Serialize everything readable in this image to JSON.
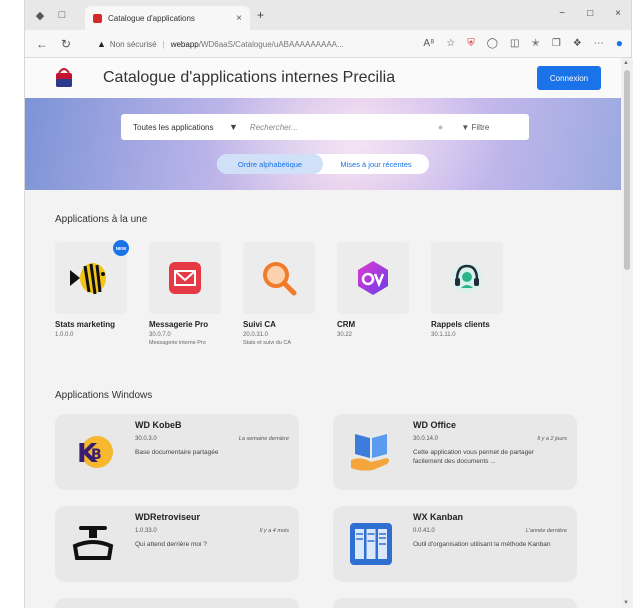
{
  "browser": {
    "tab_title": "Catalogue d'applications",
    "tab_close": "×",
    "new_tab": "+",
    "window_controls": [
      "−",
      "□",
      "×"
    ],
    "url_warning": "Non sécurisé",
    "url_separator": "|",
    "url_host": "webapp",
    "url_path": "/WD6aaS/Catalogue/uABAAAAAAAAA..."
  },
  "header": {
    "title": "Catalogue d'applications internes Precilia",
    "login_label": "Connexion"
  },
  "search": {
    "category": "Toutes les applications",
    "placeholder": "Rechercher...",
    "filter_label": "Filtre"
  },
  "sort_tabs": [
    {
      "label": "Ordre alphabétique",
      "active": true
    },
    {
      "label": "Mises à jour récentes",
      "active": false
    }
  ],
  "featured": {
    "title": "Applications à la une",
    "items": [
      {
        "name": "Stats marketing",
        "version": "1.0.0.0",
        "desc": "",
        "badge": "NEW",
        "icon": "fish-icon"
      },
      {
        "name": "Messagerie Pro",
        "version": "30.0.7.0",
        "desc": "Messagerie interne Pro",
        "icon": "mail-icon"
      },
      {
        "name": "Suivi CA",
        "version": "20.0.31.0",
        "desc": "Stats et suivi du CA",
        "icon": "magnifier-icon"
      },
      {
        "name": "CRM",
        "version": "30.22",
        "desc": "",
        "icon": "crm-icon"
      },
      {
        "name": "Rappels clients",
        "version": "30.1.11.0",
        "desc": "",
        "icon": "headset-icon"
      }
    ]
  },
  "windows": {
    "title": "Applications Windows",
    "items": [
      {
        "name": "WD KobeB",
        "version": "30.0.3.0",
        "date": "La semaine dernière",
        "desc": "Base documentaire partagée",
        "icon": "kb-logo-icon"
      },
      {
        "name": "WD Office",
        "version": "30.0.14.0",
        "date": "Il y a 2 jours",
        "desc": "Cette application vous permet de partager facilement des documents ...",
        "icon": "book-hand-icon"
      },
      {
        "name": "WDRetroviseur",
        "version": "1.0.33.0",
        "date": "Il y a 4 mois",
        "desc": "Qui attend derrière moi ?",
        "icon": "mirror-icon"
      },
      {
        "name": "WX Kanban",
        "version": "0.0.41.0",
        "date": "L'année dernière",
        "desc": "Outil d'organisation utilisant la méthode Kanban",
        "icon": "kanban-icon"
      }
    ]
  },
  "colors": {
    "accent": "#1a73e8"
  }
}
